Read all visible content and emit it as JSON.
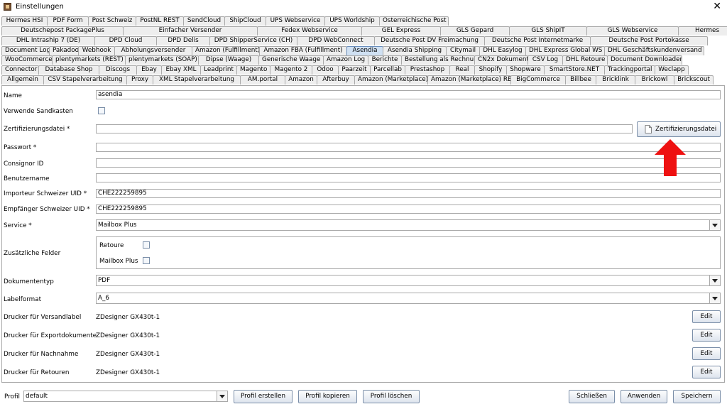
{
  "window": {
    "title": "Einstellungen",
    "close_glyph": "✕"
  },
  "tabs": {
    "row1": [
      "Hermes HSI",
      "PDF Form",
      "Post Schweiz",
      "PostNL REST",
      "SendCloud",
      "ShipCloud",
      "UPS Webservice",
      "UPS Worldship",
      "Österreichische Post"
    ],
    "row2": [
      "Deutschepost PackagePlus",
      "Einfacher Versender",
      "Fedex Webservice",
      "GEL Express",
      "GLS Gepard",
      "GLS ShipIT",
      "GLS Webservice",
      "Hermes"
    ],
    "row3": [
      "DHL Intraship 7 (DE)",
      "DPD Cloud",
      "DPD Delis",
      "DPD ShipperService (CH)",
      "DPD WebConnect",
      "Deutsche Post DV Freimachung",
      "Deutsche Post Internetmarke",
      "Deutsche Post Portokasse"
    ],
    "row4": [
      "Document Log",
      "Pakadoo",
      "Webhook",
      "Abholungsversender",
      "Amazon (Fulfillment)",
      "Amazon FBA (Fulfillment)",
      "Asendia",
      "Asendia Shipping",
      "Citymail",
      "DHL Easylog",
      "DHL Express Global WS",
      "DHL Geschäftskundenversand"
    ],
    "row5": [
      "WooCommerce",
      "plentymarkets (REST)",
      "plentymarkets (SOAP)",
      "Dipse (Waage)",
      "Generische Waage",
      "Amazon Log",
      "Berichte",
      "Bestellung als Rechnung",
      "CN2x Dokument",
      "CSV Log",
      "DHL Retoure",
      "Document Downloader"
    ],
    "row6": [
      "Connector",
      "Database Shop",
      "Discogs",
      "Ebay",
      "Ebay XML",
      "Leadprint",
      "Magento",
      "Magento 2",
      "Odoo",
      "Paarzeit",
      "Parcellab",
      "Prestashop",
      "Real",
      "Shopify",
      "Shopware",
      "SmartStore.NET",
      "Trackingportal",
      "Weclapp"
    ],
    "row7": [
      "Allgemein",
      "CSV Stapelverarbeitung",
      "Proxy",
      "XML Stapelverarbeitung",
      "AM.portal",
      "Amazon",
      "Afterbuy",
      "Amazon (Marketplace)",
      "Amazon (Marketplace) REST",
      "BigCommerce",
      "Billbee",
      "Bricklink",
      "Brickowl",
      "Brickscout"
    ],
    "active": "Asendia"
  },
  "form": {
    "name": {
      "label": "Name",
      "value": "asendia"
    },
    "sandbox": {
      "label": "Verwende Sandkasten"
    },
    "cert": {
      "label": "Zertifizierungsdatei *",
      "value": "",
      "button": "Zertifizierungsdatei"
    },
    "password": {
      "label": "Passwort *",
      "value": ""
    },
    "consignor": {
      "label": "Consignor ID",
      "value": ""
    },
    "username": {
      "label": "Benutzername",
      "value": ""
    },
    "importer_uid": {
      "label": "Importeur Schweizer UID *",
      "value": "CHE222259895"
    },
    "receiver_uid": {
      "label": "Empfänger Schweizer UID *",
      "value": "CHE222259895"
    },
    "service": {
      "label": "Service *",
      "value": "Mailbox Plus"
    },
    "extra": {
      "label": "Zusätzliche Felder",
      "retoure": "Retoure",
      "mailbox_plus": "Mailbox Plus"
    },
    "doctype": {
      "label": "Dokumententyp",
      "value": "PDF"
    },
    "labelformat": {
      "label": "Labelformat",
      "value": "A_6"
    },
    "printers": [
      {
        "label": "Drucker für Versandlabel",
        "value": "ZDesigner GX430t-1",
        "button": "Edit"
      },
      {
        "label": "Drucker für Exportdokumente",
        "value": "ZDesigner GX430t-1",
        "button": "Edit"
      },
      {
        "label": "Drucker für Nachnahme",
        "value": "ZDesigner GX430t-1",
        "button": "Edit"
      },
      {
        "label": "Drucker für Retouren",
        "value": "ZDesigner GX430t-1",
        "button": "Edit"
      }
    ]
  },
  "footer": {
    "profile_label": "Profil",
    "profile_value": "default",
    "create": "Profil erstellen",
    "copy": "Profil kopieren",
    "delete": "Profil löschen",
    "close": "Schließen",
    "apply": "Anwenden",
    "save": "Speichern"
  },
  "colors": {
    "arrow": "#ee1111",
    "active_tab": "#cfe0f2"
  },
  "icons": {
    "file": "file-icon",
    "arrow": "red-arrow-icon"
  }
}
